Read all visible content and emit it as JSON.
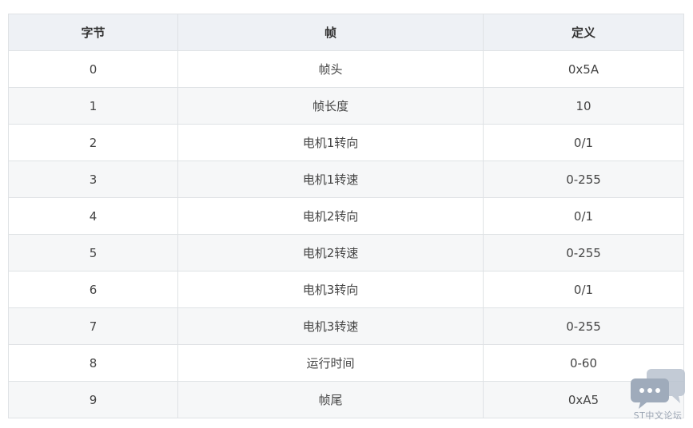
{
  "table": {
    "headers": [
      "字节",
      "帧",
      "定义"
    ],
    "rows": [
      [
        "0",
        "帧头",
        "0x5A"
      ],
      [
        "1",
        "帧长度",
        "10"
      ],
      [
        "2",
        "电机1转向",
        "0/1"
      ],
      [
        "3",
        "电机1转速",
        "0-255"
      ],
      [
        "4",
        "电机2转向",
        "0/1"
      ],
      [
        "5",
        "电机2转速",
        "0-255"
      ],
      [
        "6",
        "电机3转向",
        "0/1"
      ],
      [
        "7",
        "电机3转速",
        "0-255"
      ],
      [
        "8",
        "运行时间",
        "0-60"
      ],
      [
        "9",
        "帧尾",
        "0xA5"
      ]
    ]
  },
  "watermark": {
    "text": "ST中文论坛",
    "icon": "chat-bubbles-icon"
  }
}
